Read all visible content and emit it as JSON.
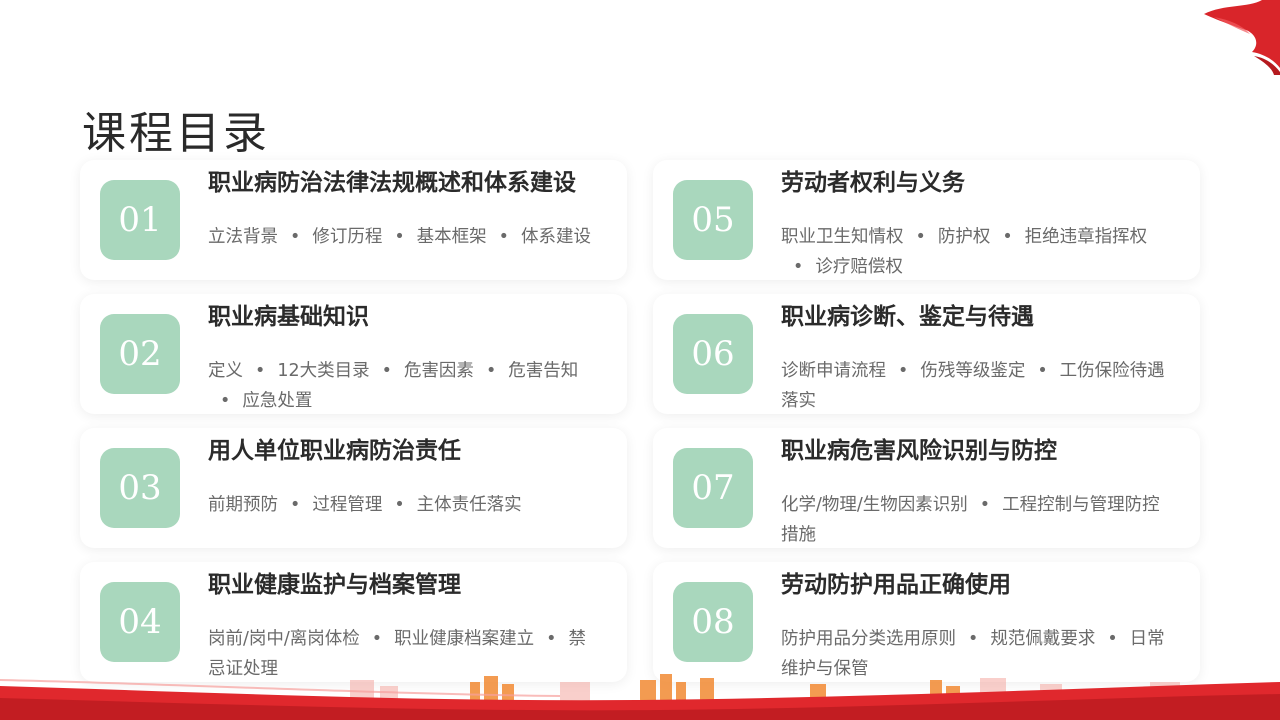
{
  "title": "课程目录",
  "colors": {
    "accent_green": "#a9d7bd",
    "ribbon_red": "#d9252a"
  },
  "items": [
    {
      "num": "01",
      "title": "职业病防治法律法规概述和体系建设",
      "desc": [
        "立法背景",
        "修订历程",
        "基本框架",
        "体系建设"
      ]
    },
    {
      "num": "05",
      "title": "劳动者权利与义务",
      "desc": [
        "职业卫生知情权",
        "防护权",
        "拒绝违章指挥权",
        "诊疗赔偿权"
      ]
    },
    {
      "num": "02",
      "title": "职业病基础知识",
      "desc": [
        "定义",
        "12大类目录",
        "危害因素",
        "危害告知",
        "应急处置"
      ]
    },
    {
      "num": "06",
      "title": "职业病诊断、鉴定与待遇",
      "desc": [
        "诊断申请流程",
        "伤残等级鉴定",
        "工伤保险待遇落实"
      ]
    },
    {
      "num": "03",
      "title": "用人单位职业病防治责任",
      "desc": [
        "前期预防",
        "过程管理",
        "主体责任落实"
      ]
    },
    {
      "num": "07",
      "title": "职业病危害风险识别与防控",
      "desc": [
        "化学/物理/生物因素识别",
        "工程控制与管理防控措施"
      ]
    },
    {
      "num": "04",
      "title": "职业健康监护与档案管理",
      "desc": [
        "岗前/岗中/离岗体检",
        "职业健康档案建立",
        "禁忌证处理"
      ]
    },
    {
      "num": "08",
      "title": "劳动防护用品正确使用",
      "desc": [
        "防护用品分类选用原则",
        "规范佩戴要求",
        "日常维护与保管"
      ]
    }
  ]
}
